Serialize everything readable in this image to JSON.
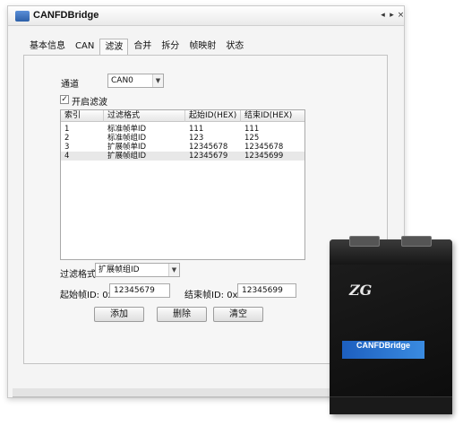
{
  "window": {
    "title": "CANFDBridge",
    "controls": [
      "◂",
      "▸",
      "×"
    ]
  },
  "tabs": [
    {
      "label": "基本信息",
      "active": false
    },
    {
      "label": "CAN",
      "active": false
    },
    {
      "label": "滤波",
      "active": true
    },
    {
      "label": "合并",
      "active": false
    },
    {
      "label": "拆分",
      "active": false
    },
    {
      "label": "帧映射",
      "active": false
    },
    {
      "label": "状态",
      "active": false
    }
  ],
  "filter": {
    "channel_label": "通道",
    "channel_value": "CAN0",
    "enable_label": "开启滤波",
    "enable_checked": true,
    "table": {
      "columns": [
        "索引",
        "过滤格式",
        "起始ID(HEX)",
        "结束ID(HEX)"
      ],
      "rows": [
        [
          "1",
          "标准帧单ID",
          "111",
          "111"
        ],
        [
          "2",
          "标准帧组ID",
          "123",
          "125"
        ],
        [
          "3",
          "扩展帧单ID",
          "12345678",
          "12345678"
        ],
        [
          "4",
          "扩展帧组ID",
          "12345679",
          "12345699"
        ]
      ]
    },
    "format_label": "过滤格式",
    "format_value": "扩展帧组ID",
    "start_label": "起始帧ID: 0x",
    "start_value": "12345679",
    "end_label": "结束帧ID: 0x",
    "end_value": "12345699",
    "buttons": {
      "add": "添加",
      "delete": "删除",
      "clear": "清空"
    }
  },
  "device": {
    "brand": "CANFDBridge",
    "logo": "ZG"
  }
}
